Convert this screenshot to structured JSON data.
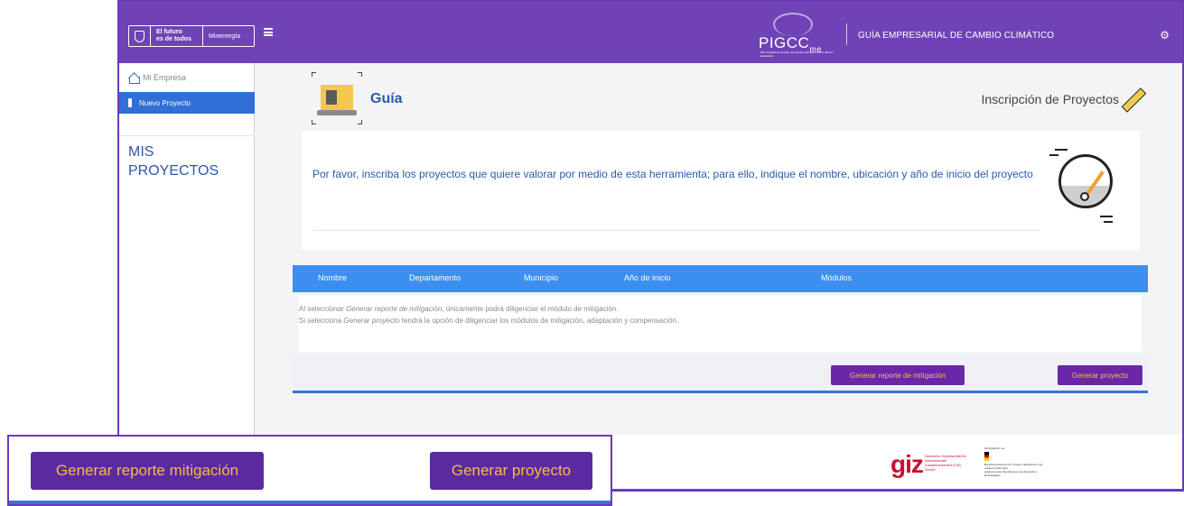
{
  "header": {
    "gov_logo_line1": "El futuro",
    "gov_logo_line2": "es de todos",
    "gov_logo_ministry": "Minenergía",
    "brand_name": "PIGCC",
    "brand_suffix": "me",
    "brand_tagline": "Plan Integral de Gestión del Cambio Climático Sector Minero Energético",
    "title": "GUÍA EMPRESARIAL DE CAMBIO CLIMÁTICO",
    "settings_icon": "gear-icon"
  },
  "sidebar": {
    "home_label": "Mi Empresa",
    "active_item_label": "Nuevo Proyecto",
    "section_line1": "MIS",
    "section_line2": "PROYECTOS"
  },
  "page": {
    "guide_label": "Guía",
    "inscription_label": "Inscripción de Proyectos",
    "instruction": "Por favor, inscriba los proyectos que quiere valorar por medio de esta herramienta; para ello, indique el nombre, ubicación y año de inicio del proyecto"
  },
  "table": {
    "columns": [
      "Nombre",
      "Departamento",
      "Municipio",
      "Año de inicio",
      "Módulos"
    ],
    "note1_prefix": "Al seleccionar ",
    "note1_em": "Generar reporte de mitigación",
    "note1_suffix": ", únicamente podrá diligenciar el módulo de mitigación.",
    "note2_prefix": "Si selecciona ",
    "note2_em": "Generar proyecto",
    "note2_suffix": " tendrá la opción de diligenciar los módulos de mitigación, adaptación y compensación.",
    "btn_report": "Generar reporte de mitigación",
    "btn_project": "Generar proyecto"
  },
  "footer": {
    "giz_logo": "giz",
    "giz_name": "Deutsche Gesellschaft für Internationale Zusammenarbeit (GIZ) GmbH",
    "de_intro": "Durchgeführt von",
    "de_ministry": "Bundesministerium für Umwelt, Naturschutz und nukleare Sicherheit",
    "de_basis": "aufgrund eines Beschlusses des Deutschen Bundestages"
  },
  "zoom": {
    "btn_report": "Generar reporte mitigación",
    "btn_project": "Generar proyecto"
  },
  "colors": {
    "primary_purple": "#6f42b6",
    "accent_blue": "#3c8ef0",
    "button_text": "#f5c04a",
    "link_blue": "#2c5aa8"
  }
}
